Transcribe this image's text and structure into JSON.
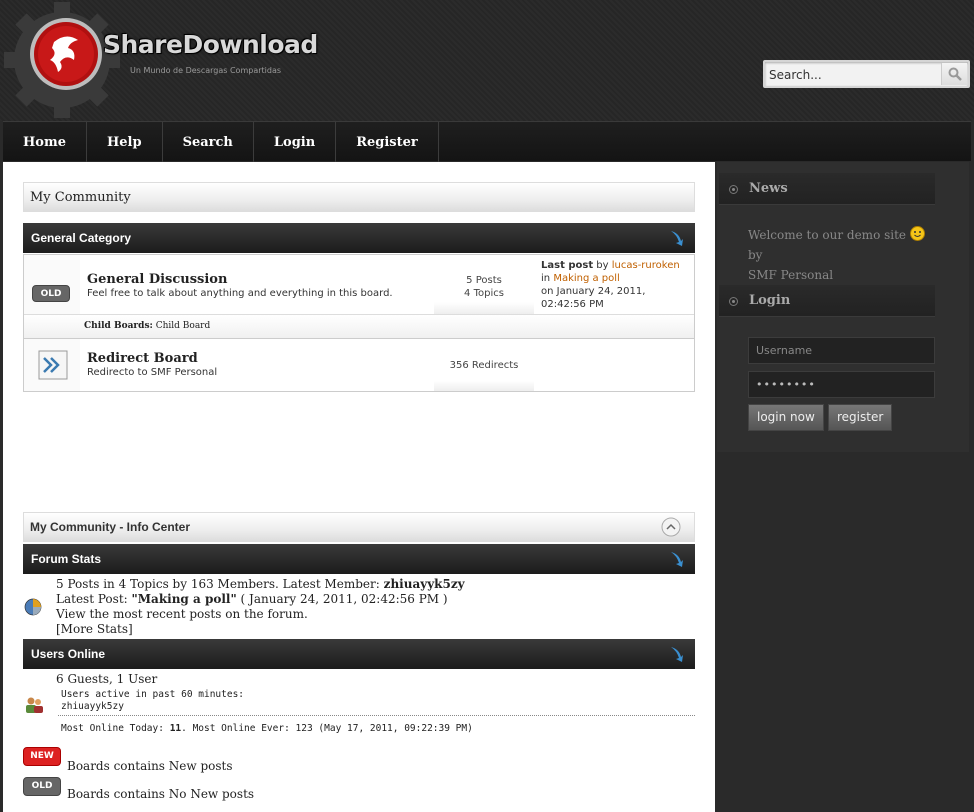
{
  "header": {
    "logo_title": "ShareDownload",
    "logo_subtitle": "Un Mundo de Descargas Compartidas",
    "search_placeholder": "Search..."
  },
  "nav": {
    "items": [
      "Home",
      "Help",
      "Search",
      "Login",
      "Register"
    ]
  },
  "main": {
    "linktree": "My Community",
    "category": {
      "title": "General Category",
      "boards": [
        {
          "name": "General Discussion",
          "description": "Feel free to talk about anything and everything in this board.",
          "badge": "OLD",
          "posts": "5 Posts",
          "topics": "4 Topics",
          "lastpost_label": "Last post",
          "lastpost_by": "by",
          "lastpost_user": "lucas-ruroken",
          "lastpost_in": "in",
          "lastpost_topic": "Making a poll",
          "lastpost_date": "on January 24, 2011,",
          "lastpost_time": "02:42:56 PM",
          "child_label": "Child Boards:",
          "child_board": "Child Board"
        },
        {
          "name": "Redirect Board",
          "description": "Redirecto to SMF Personal",
          "redirects": "356 Redirects"
        }
      ]
    },
    "info_center": {
      "title": "My Community - Info Center",
      "forum_stats": {
        "title": "Forum Stats",
        "line1_prefix": "5 Posts in 4 Topics by 163 Members. Latest Member:",
        "latest_member": "zhiuayyk5zy",
        "line2_prefix": "Latest Post:",
        "latest_post": "\"Making a poll\"",
        "latest_post_date": "( January 24, 2011, 02:42:56 PM )",
        "line3": "View the most recent posts on the forum.",
        "line4": "[More Stats]"
      },
      "users_online": {
        "title": "Users Online",
        "summary": "6 Guests, 1 User",
        "active_label": "Users active in past 60 minutes:",
        "active_user": "zhiuayyk5zy",
        "most_online_prefix": "Most Online Today:",
        "most_online_today": "11",
        "most_online_suffix": ". Most Online Ever: 123 (May 17, 2011, 09:22:39 PM)"
      },
      "legend": {
        "new_badge": "NEW",
        "new_text": "Boards contains New posts",
        "old_badge": "OLD",
        "old_text": "Boards contains No New posts"
      }
    }
  },
  "sidebar": {
    "news_title": "News",
    "news_text_before": "Welcome to our demo site",
    "news_text_after": "by",
    "news_text_line2": "SMF Personal",
    "login_title": "Login",
    "username_placeholder": "Username",
    "password_value": "••••••••",
    "login_button": "login now",
    "register_button": "register"
  },
  "colors": {
    "accent_link": "#c06000",
    "new_badge": "#dd2222",
    "old_badge": "#666666"
  }
}
